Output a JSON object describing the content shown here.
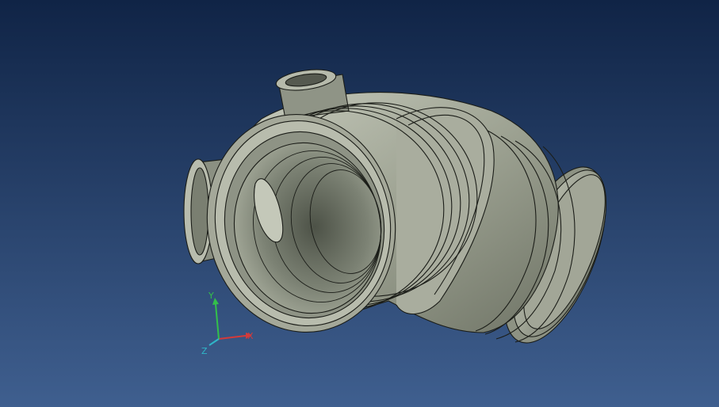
{
  "viewport": {
    "background_top": "#102446",
    "background_bottom": "#3f5f8f"
  },
  "model": {
    "name": "",
    "face_color": "#9aa08f",
    "edge_color": "#1b1d18"
  },
  "triad": {
    "x_label": "X",
    "y_label": "Y",
    "z_label": "Z",
    "x_color": "#d33a3a",
    "y_color": "#33c04a",
    "z_color": "#2fb6c8"
  }
}
